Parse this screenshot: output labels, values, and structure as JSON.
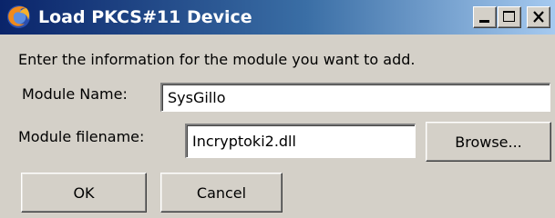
{
  "window": {
    "title": "Load PKCS#11 Device",
    "app_icon": "firefox-icon",
    "caption_buttons": [
      "minimize-icon",
      "maximize-icon",
      "close-icon"
    ]
  },
  "form": {
    "instruction": "Enter the information for the module you want to add.",
    "module_name_label": "Module Name:",
    "module_name_value": "SysGillo",
    "module_filename_label": "Module filename:",
    "module_filename_value": "Incryptoki2.dll"
  },
  "buttons": {
    "browse": "Browse...",
    "ok": "OK",
    "cancel": "Cancel"
  },
  "colors": {
    "titlebar_start": "#0a246a",
    "titlebar_end": "#a6caf0",
    "dialog_background": "#d4d0c8"
  }
}
